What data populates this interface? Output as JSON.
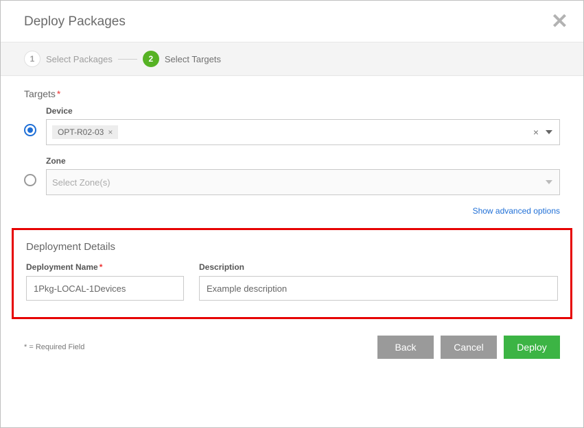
{
  "dialog": {
    "title": "Deploy Packages"
  },
  "steps": {
    "step1": {
      "num": "1",
      "label": "Select Packages"
    },
    "step2": {
      "num": "2",
      "label": "Select Targets"
    }
  },
  "targets": {
    "heading": "Targets",
    "device": {
      "label": "Device",
      "chip": "OPT-R02-03",
      "chip_x": "×",
      "clear_x": "×"
    },
    "zone": {
      "label": "Zone",
      "placeholder": "Select Zone(s)"
    },
    "advanced_link": "Show advanced options"
  },
  "details": {
    "heading": "Deployment Details",
    "name_label": "Deployment Name",
    "name_value": "1Pkg-LOCAL-1Devices",
    "desc_label": "Description",
    "desc_value": "Example description"
  },
  "footer": {
    "note": "* = Required Field",
    "back": "Back",
    "cancel": "Cancel",
    "deploy": "Deploy"
  }
}
